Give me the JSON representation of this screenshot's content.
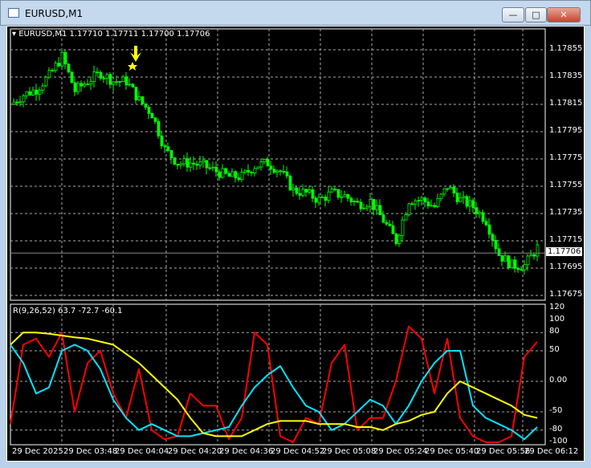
{
  "window": {
    "title": "EURUSD,M1",
    "minimize": "—",
    "maximize": "□",
    "close": "✕"
  },
  "chart": {
    "header": "EURUSD,M1  1.17710 1.17711 1.17700 1.17706",
    "current_price": "1.17706",
    "price_ticks": [
      "1.17855",
      "1.17835",
      "1.17815",
      "1.17795",
      "1.17775",
      "1.17755",
      "1.17735",
      "1.17715",
      "1.17695",
      "1.17675"
    ],
    "time_ticks": [
      "29 Dec 2025",
      "29 Dec 03:48",
      "29 Dec 04:04",
      "29 Dec 04:20",
      "29 Dec 04:36",
      "29 Dec 04:52",
      "29 Dec 05:08",
      "29 Dec 05:24",
      "29 Dec 05:40",
      "29 Dec 05:56",
      "29 Dec 06:12"
    ],
    "colors": {
      "bull": "#00ff00",
      "bear": "#00ff00",
      "bg": "#000000",
      "grid": "#c0c0c0",
      "marker": "#ffff00"
    },
    "marker_icon": "arrow-down-star-icon"
  },
  "indicator": {
    "header": "R(9,26,52) 63.7 -72.7 -60.1",
    "ticks": [
      "120",
      "100",
      "80",
      "50",
      "0.00",
      "-50",
      "-80",
      "-100"
    ],
    "colors": {
      "fast": "#ff0000",
      "mid": "#00e5ff",
      "slow": "#ffff00"
    }
  },
  "chart_data": [
    {
      "type": "candlestick",
      "title": "EURUSD,M1",
      "ylim": [
        1.1767,
        1.1787
      ],
      "closes": [
        1.17815,
        1.17822,
        1.17826,
        1.17836,
        1.1785,
        1.17825,
        1.17832,
        1.17838,
        1.17832,
        1.17832,
        1.17818,
        1.17808,
        1.17782,
        1.17772,
        1.17772,
        1.1777,
        1.17766,
        1.17762,
        1.17762,
        1.1777,
        1.17772,
        1.17766,
        1.17752,
        1.1775,
        1.17745,
        1.1775,
        1.17748,
        1.17742,
        1.17744,
        1.1773,
        1.17715,
        1.17745,
        1.17745,
        1.1774,
        1.17755,
        1.17745,
        1.1774,
        1.1773,
        1.17705,
        1.17697,
        1.17697,
        1.1771
      ]
    },
    {
      "type": "line",
      "title": "R(9,26,52)",
      "ylim": [
        -100,
        120
      ],
      "series": [
        {
          "values": [
            -70,
            60,
            70,
            40,
            80,
            -50,
            30,
            50,
            -20,
            -60,
            20,
            -80,
            -95,
            -90,
            -20,
            -40,
            -40,
            -95,
            -60,
            80,
            60,
            -90,
            -100,
            -60,
            -70,
            30,
            60,
            -80,
            -60,
            -60,
            0,
            90,
            70,
            -20,
            70,
            -60,
            -90,
            -100,
            -100,
            -90,
            40,
            65
          ]
        },
        {
          "values": [
            60,
            30,
            -20,
            -10,
            50,
            60,
            50,
            20,
            -30,
            -60,
            -80,
            -70,
            -80,
            -90,
            -90,
            -85,
            -80,
            -75,
            -40,
            -10,
            10,
            25,
            -10,
            -40,
            -50,
            -80,
            -70,
            -50,
            -30,
            -40,
            -70,
            -40,
            0,
            30,
            50,
            50,
            -40,
            -60,
            -70,
            -80,
            -95,
            -75
          ]
        },
        {
          "values": [
            60,
            80,
            80,
            78,
            75,
            72,
            70,
            65,
            60,
            45,
            30,
            10,
            -10,
            -30,
            -60,
            -85,
            -90,
            -90,
            -90,
            -80,
            -70,
            -65,
            -65,
            -65,
            -70,
            -70,
            -70,
            -75,
            -75,
            -80,
            -70,
            -65,
            -55,
            -50,
            -20,
            0,
            -10,
            -20,
            -30,
            -40,
            -55,
            -60
          ]
        }
      ]
    }
  ]
}
